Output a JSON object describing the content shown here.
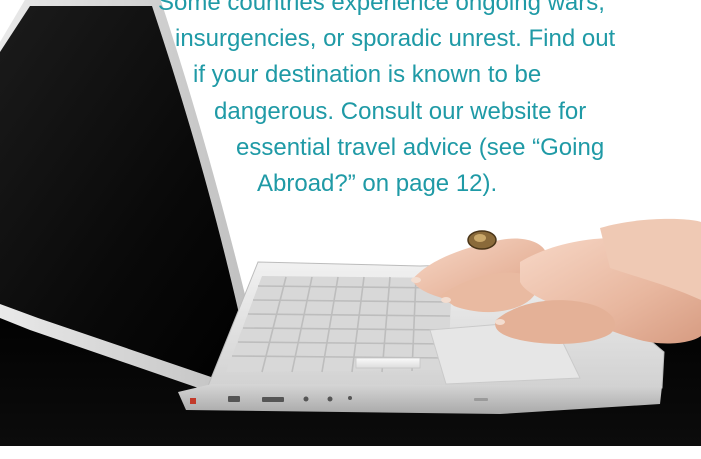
{
  "text": {
    "lines": [
      "Some countries experience ongoing wars,",
      "insurgencies, or sporadic unrest. Find out",
      "if your destination is known to be",
      "dangerous. Consult our website for",
      "essential travel advice (see “Going",
      "Abroad?” on page 12)."
    ]
  },
  "colors": {
    "text": "#1f9aa6",
    "table_shadow": "#000000",
    "background": "#ffffff"
  }
}
